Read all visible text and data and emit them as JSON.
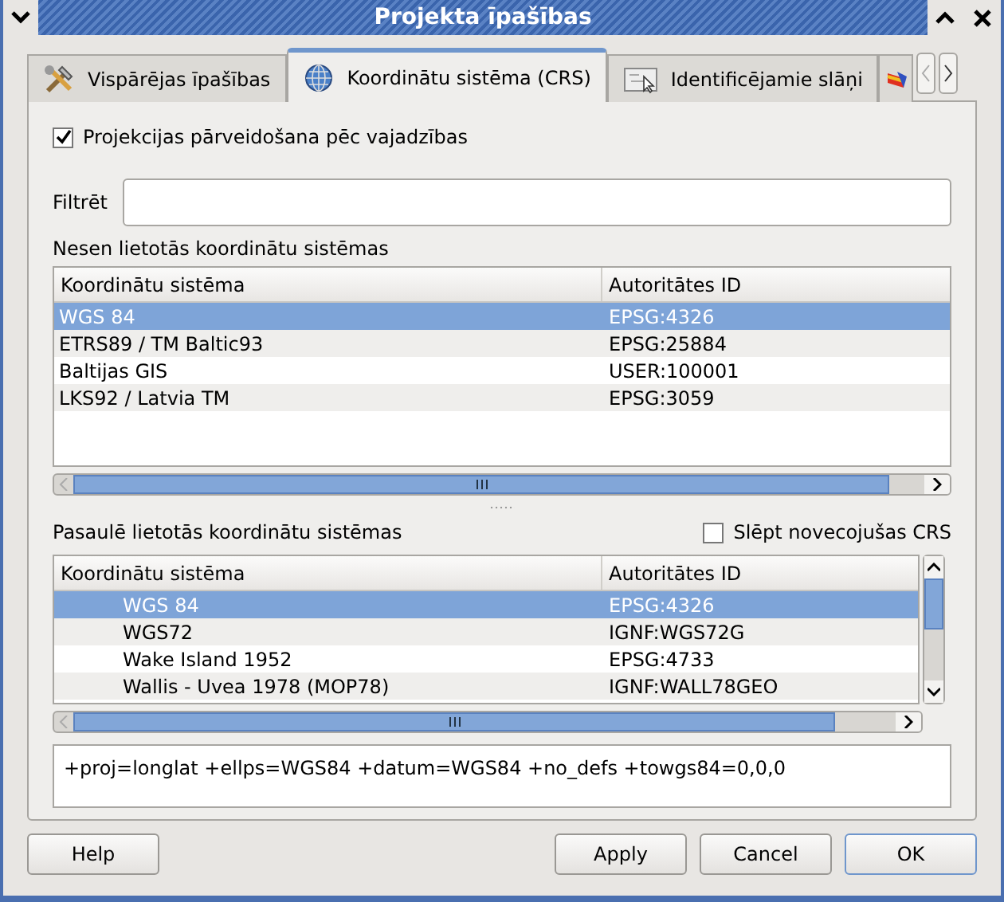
{
  "window": {
    "title": "Projekta īpašības"
  },
  "tabs": [
    {
      "label": "Vispārējas īpašības",
      "kind": "tools",
      "selected": false
    },
    {
      "label": "Koordinātu sistēma (CRS)",
      "kind": "globe",
      "selected": true
    },
    {
      "label": "Identificējamie slāņi",
      "kind": "map",
      "selected": false
    },
    {
      "kind": "layers",
      "selected": false
    }
  ],
  "on_the_fly": {
    "label": "Projekcijas pārveidošana pēc vajadzības",
    "checked": true
  },
  "filter": {
    "label": "Filtrēt"
  },
  "recent": {
    "title": "Nesen lietotās koordinātu sistēmas",
    "columns": [
      "Koordinātu sistēma",
      "Autoritātes ID"
    ],
    "rows": [
      {
        "name": "WGS 84",
        "id": "EPSG:4326",
        "selected": true
      },
      {
        "name": "ETRS89 / TM Baltic93",
        "id": "EPSG:25884",
        "selected": false
      },
      {
        "name": "Baltijas GIS",
        "id": "USER:100001",
        "selected": false
      },
      {
        "name": "LKS92 / Latvia TM",
        "id": "EPSG:3059",
        "selected": false
      }
    ]
  },
  "world": {
    "title": "Pasaulē lietotās koordinātu sistēmas",
    "hide_deprecated": {
      "label": "Slēpt novecojušas CRS",
      "checked": false
    },
    "columns": [
      "Koordinātu sistēma",
      "Autoritātes ID"
    ],
    "rows": [
      {
        "name": "WGS 84",
        "id": "EPSG:4326",
        "selected": true
      },
      {
        "name": "WGS72",
        "id": "IGNF:WGS72G",
        "selected": false
      },
      {
        "name": "Wake Island 1952",
        "id": "EPSG:4733",
        "selected": false
      },
      {
        "name": "Wallis - Uvea 1978 (MOP78)",
        "id": "IGNF:WALL78GEO",
        "selected": false
      }
    ]
  },
  "proj_string": "+proj=longlat +ellps=WGS84 +datum=WGS84 +no_defs +towgs84=0,0,0",
  "buttons": [
    {
      "label": "Help",
      "kind": "left",
      "default": false
    },
    {
      "label": "Apply",
      "kind": "right",
      "default": false
    },
    {
      "label": "Cancel",
      "kind": "right",
      "default": false
    },
    {
      "label": "OK",
      "kind": "right",
      "default": true
    }
  ]
}
